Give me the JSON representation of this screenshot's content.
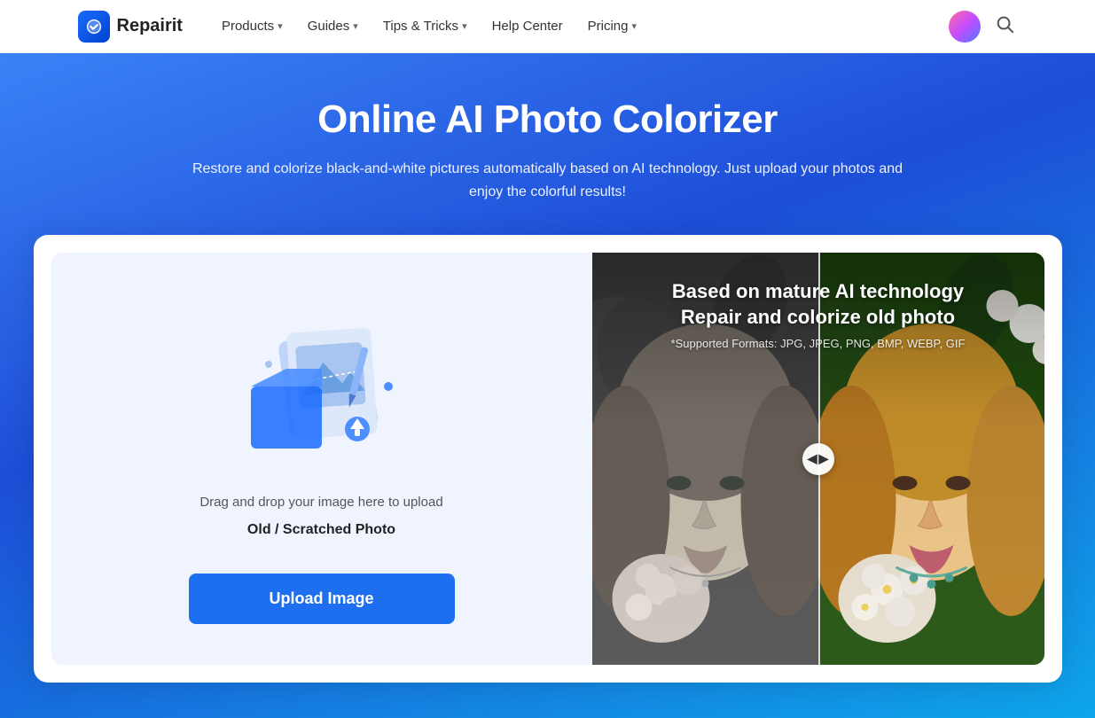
{
  "nav": {
    "logo_text": "Repairit",
    "items": [
      {
        "label": "Products",
        "has_dropdown": true
      },
      {
        "label": "Guides",
        "has_dropdown": true
      },
      {
        "label": "Tips & Tricks",
        "has_dropdown": true
      },
      {
        "label": "Help Center",
        "has_dropdown": false
      },
      {
        "label": "Pricing",
        "has_dropdown": true
      }
    ]
  },
  "hero": {
    "title": "Online AI Photo Colorizer",
    "description": "Restore and colorize black-and-white pictures automatically based on AI technology. Just upload your photos and enjoy the colorful results!"
  },
  "upload": {
    "drag_text": "Drag and drop your image here to upload",
    "file_type": "Old / Scratched Photo",
    "button_label": "Upload Image"
  },
  "preview": {
    "title_line1": "Based on mature AI technology",
    "title_line2": "Repair and colorize old photo",
    "formats_label": "*Supported Formats:",
    "formats_value": "JPG, JPEG, PNG, BMP, WEBP, GIF"
  }
}
